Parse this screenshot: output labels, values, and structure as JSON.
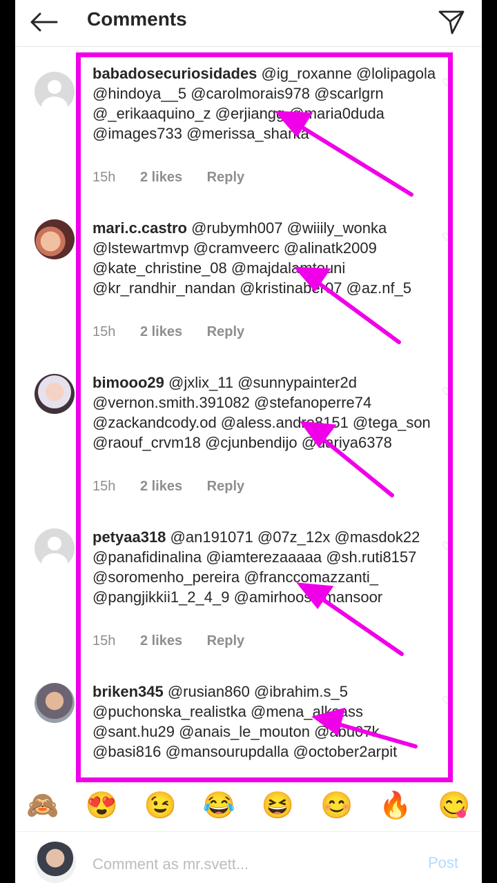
{
  "header": {
    "title": "Comments"
  },
  "comments": [
    {
      "user": "babadosecuriosidades",
      "text": " @ig_roxanne @lolipagola @hindoya__5 @carolmorais978 @scarlgrn @_erikaaquino_z @erjiangg @maria0duda @images73",
      "text2": "3 @merissa_shanta",
      "time": "15h",
      "likes": "2 likes",
      "reply": "Reply",
      "avatar": "default-avatar-icon"
    },
    {
      "user": "mari.c.castro",
      "text": " @rubymh007 @wiiily_wonka @lstewartmvp @cramveerc @alinatk2009 @kate_christine_08 @majdalamtouni @kr_randhir_nandan @kristina",
      "text2": "ber07 @az.nf_5",
      "time": "15h",
      "likes": "2 likes",
      "reply": "Reply",
      "avatar": "photo"
    },
    {
      "user": "bimooo29",
      "text": " @jxlix_11 @sunnypainter2d @vernon.smith.391082 @stefanoperre74 @zackandcody.od @aless.andro8151 @tega_son @raouf_crvm18 @",
      "text2": "cjunbendijo @dariya6378",
      "time": "15h",
      "likes": "2 likes",
      "reply": "Reply",
      "avatar": "photo"
    },
    {
      "user": "petyaa318",
      "text": " @an191071 @07z_12x @masdok22 @panafidinalina @iamterezaaaaa @sh.ruti8157 @soromenho_pereira @franc",
      "text2": "comazzanti_ @pangjikkii1_2_4_9 @amirhoosei",
      "text3": "mansoor",
      "time": "15h",
      "likes": "2 likes",
      "reply": "Reply",
      "avatar": "default-avatar-icon"
    },
    {
      "user": "briken345",
      "text": " @rusian860 @ibrahim.s_5 @puchonska_realistka @mena_alksass @sant.hu29 @anais_le_mouton @abu07k @basi816 @mansourupdalla @october2arpit",
      "text2": "",
      "time": "",
      "likes": "",
      "reply": "",
      "avatar": "photo"
    }
  ],
  "emojis": [
    "🙈",
    "😍",
    "😉",
    "😂",
    "😆",
    "😊",
    "🔥",
    "😋"
  ],
  "composer": {
    "placeholder": "Comment as mr.svett...",
    "post_label": "Post"
  },
  "annotation": {
    "color": "#f000e8"
  }
}
